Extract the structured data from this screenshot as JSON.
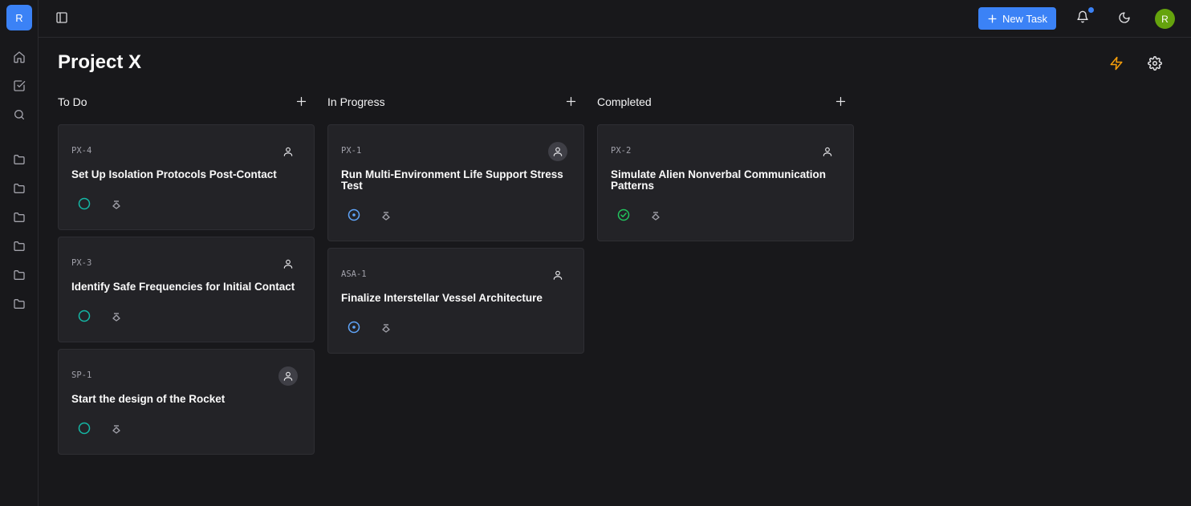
{
  "workspace": {
    "initial": "R"
  },
  "sidebar": {
    "icons": [
      "home-icon",
      "tasks-icon",
      "search-icon",
      "folder-icon",
      "folder-icon",
      "folder-icon",
      "folder-icon",
      "folder-icon",
      "folder-icon"
    ]
  },
  "topbar": {
    "new_task_label": "New Task",
    "user_initial": "R",
    "accent": "#3b82f6"
  },
  "project": {
    "title": "Project X"
  },
  "columns": [
    {
      "title": "To Do",
      "cards": [
        {
          "id": "PX-4",
          "title": "Set Up Isolation Protocols Post-Contact",
          "status": "todo"
        },
        {
          "id": "PX-3",
          "title": "Identify Safe Frequencies for Initial Contact",
          "status": "todo"
        },
        {
          "id": "SP-1",
          "title": "Start the design of the Rocket",
          "status": "todo"
        }
      ]
    },
    {
      "title": "In Progress",
      "cards": [
        {
          "id": "PX-1",
          "title": "Run Multi-Environment Life Support Stress Test",
          "status": "in-progress"
        },
        {
          "id": "ASA-1",
          "title": "Finalize Interstellar Vessel Architecture",
          "status": "in-progress"
        }
      ]
    },
    {
      "title": "Completed",
      "cards": [
        {
          "id": "PX-2",
          "title": "Simulate Alien Nonverbal Communication Patterns",
          "status": "completed"
        }
      ]
    }
  ],
  "status_colors": {
    "todo": "#14b8a6",
    "in-progress": "#60a5fa",
    "completed": "#22c55e"
  }
}
